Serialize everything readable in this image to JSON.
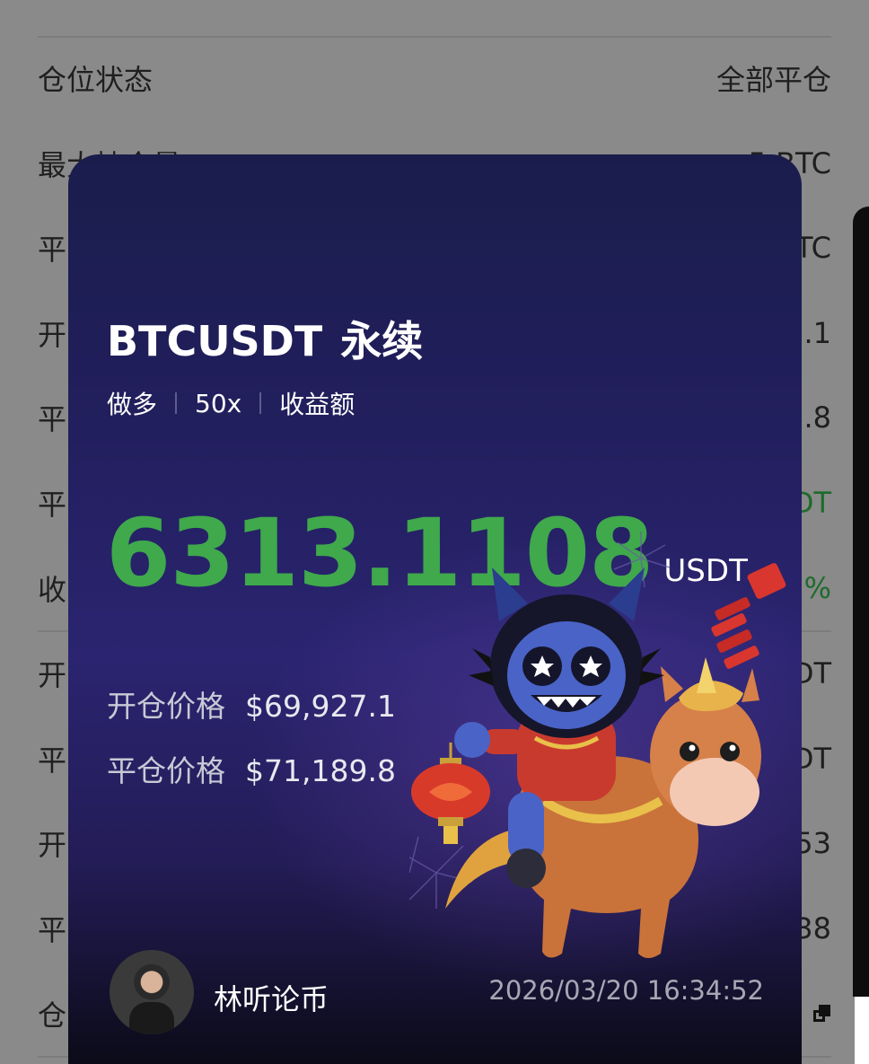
{
  "background_list": {
    "rows": [
      {
        "label": "仓位状态",
        "value": "全部平仓",
        "green": false
      },
      {
        "label": "最大持仓量",
        "value": "5 BTC",
        "green": false
      },
      {
        "label": "平",
        "value": "TC",
        "green": false
      },
      {
        "label": "开",
        "value": "7.1",
        "green": false
      },
      {
        "label": "平",
        "value": ".8",
        "green": false
      },
      {
        "label": "平",
        "value": "DT",
        "green": true
      },
      {
        "label": "收",
        "value": "%",
        "green": true
      },
      {
        "label": "开",
        "value": "DT",
        "green": false
      },
      {
        "label": "平",
        "value": "DT",
        "green": false
      },
      {
        "label": "开",
        "value": "53",
        "green": false
      },
      {
        "label": "平",
        "value": "38",
        "green": false
      },
      {
        "label": "仓",
        "value": "",
        "green": false
      }
    ]
  },
  "card": {
    "pair": "BTCUSDT",
    "contract_type": "永续",
    "tags": [
      "做多",
      "50x",
      "收益额"
    ],
    "pnl_value": "6313.1108",
    "pnl_unit": "USDT",
    "open_price_label": "开仓价格",
    "open_price_value": "$69,927.1",
    "close_price_label": "平仓价格",
    "close_price_value": "$71,189.8",
    "author": "林听论币",
    "timestamp": "2026/03/20 16:34:52"
  },
  "colors": {
    "profit_green": "#3fa94c",
    "card_bg": "#221f5e",
    "page_bg": "#8a8a8a"
  },
  "icons": [
    "copy-icon",
    "mascot-illustration",
    "firecracker-icon",
    "lantern-icon",
    "avatar"
  ]
}
